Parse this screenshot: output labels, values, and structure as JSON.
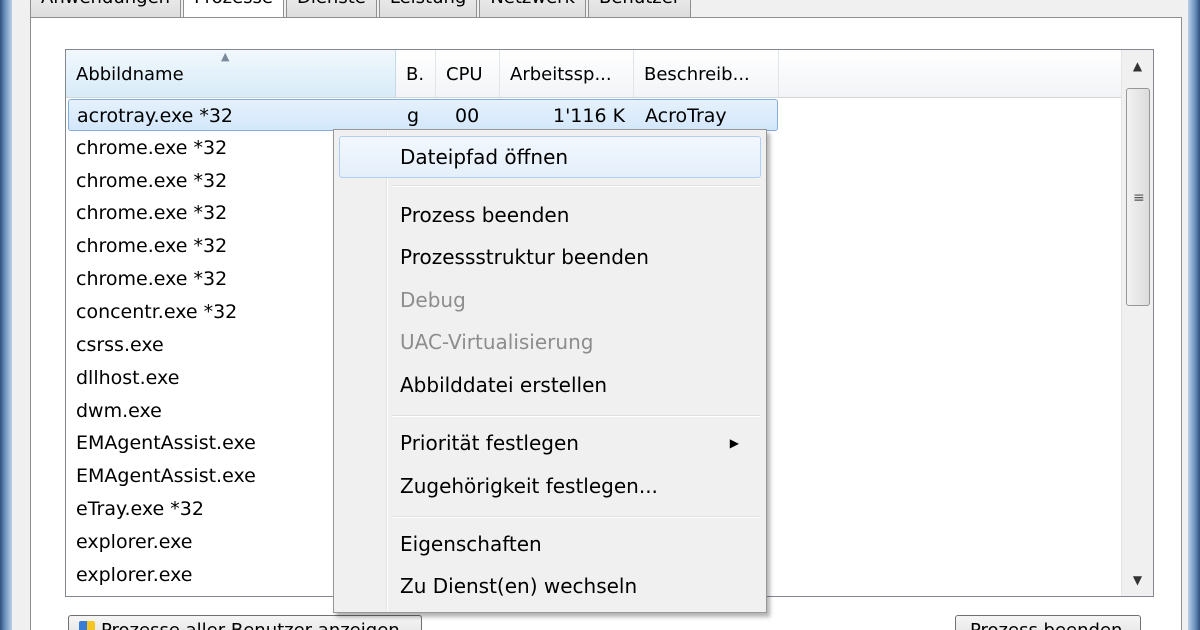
{
  "tabs": [
    {
      "label": "Anwendungen"
    },
    {
      "label": "Prozesse"
    },
    {
      "label": "Dienste"
    },
    {
      "label": "Leistung"
    },
    {
      "label": "Netzwerk"
    },
    {
      "label": "Benutzer"
    }
  ],
  "active_tab": "Prozesse",
  "columns": [
    {
      "label": "Abbildname"
    },
    {
      "label": "B."
    },
    {
      "label": "CPU"
    },
    {
      "label": "Arbeitssp..."
    },
    {
      "label": "Beschreib..."
    }
  ],
  "sort": {
    "column": "Abbildname",
    "direction": "ascending"
  },
  "rows": [
    {
      "name": "acrotray.exe *32",
      "user": "g",
      "cpu": "00",
      "memory": "1'116 K",
      "description": "AcroTray",
      "selected": true
    },
    {
      "name": "chrome.exe *32"
    },
    {
      "name": "chrome.exe *32"
    },
    {
      "name": "chrome.exe *32"
    },
    {
      "name": "chrome.exe *32"
    },
    {
      "name": "chrome.exe *32"
    },
    {
      "name": "concentr.exe *32"
    },
    {
      "name": "csrss.exe"
    },
    {
      "name": "dllhost.exe"
    },
    {
      "name": "dwm.exe"
    },
    {
      "name": "EMAgentAssist.exe"
    },
    {
      "name": "EMAgentAssist.exe"
    },
    {
      "name": "eTray.exe *32"
    },
    {
      "name": "explorer.exe"
    },
    {
      "name": "explorer.exe"
    }
  ],
  "context_menu": {
    "items": [
      {
        "label": "Dateipfad öffnen",
        "state": "hover"
      },
      {
        "label": "Prozess beenden"
      },
      {
        "label": "Prozessstruktur beenden"
      },
      {
        "label": "Debug",
        "state": "disabled"
      },
      {
        "label": "UAC-Virtualisierung",
        "state": "disabled"
      },
      {
        "label": "Abbilddatei erstellen"
      },
      {
        "label": "Priorität festlegen",
        "submenu": true
      },
      {
        "label": "Zugehörigkeit festlegen..."
      },
      {
        "label": "Eigenschaften"
      },
      {
        "label": "Zu Dienst(en) wechseln"
      }
    ]
  },
  "buttons": {
    "show_all": "Prozesse aller Benutzer anzeigen",
    "end_process": "Prozess beenden"
  },
  "icons": {
    "sort_indicator": "sort-up-icon",
    "scroll_up": "arrow-up-icon",
    "scroll_down": "arrow-down-icon",
    "submenu": "chevron-right-icon",
    "uac": "shield-icon"
  },
  "colors": {
    "selection_fill": "#d3e7fb",
    "selection_border": "#84acdd",
    "menu_background": "#f0f0f0",
    "disabled_text": "#8d8d8d"
  }
}
